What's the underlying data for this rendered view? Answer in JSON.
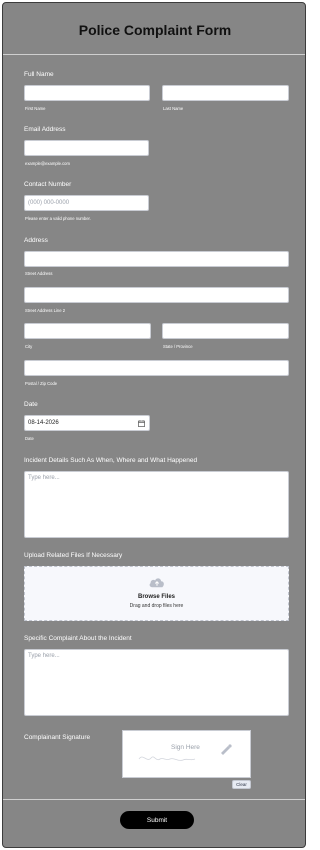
{
  "form": {
    "title": "Police Complaint Form",
    "submit_label": "Submit"
  },
  "full_name": {
    "label": "Full Name",
    "first_sub": "First Name",
    "last_sub": "Last Name",
    "first_value": "",
    "last_value": ""
  },
  "email": {
    "label": "Email Address",
    "sub": "example@example.com",
    "value": ""
  },
  "contact": {
    "label": "Contact Number",
    "placeholder": "(000) 000-0000",
    "sub": "Please enter a valid phone number."
  },
  "address": {
    "label": "Address",
    "street_sub": "Street Address",
    "street2_sub": "Street Address Line 2",
    "city_sub": "City",
    "state_sub": "State / Province",
    "postal_sub": "Postal / Zip Code"
  },
  "date": {
    "label": "Date",
    "value": "08-14-2026",
    "sub": "Date",
    "icon": "calendar-icon"
  },
  "incident": {
    "label": "Incident Details Such As When, Where and What Happened",
    "placeholder": "Type here..."
  },
  "upload": {
    "label": "Upload Related Files If Necessary",
    "browse": "Browse Files",
    "drag": "Drag and drop files here",
    "icon": "cloud-upload-icon"
  },
  "complaint": {
    "label": "Specific Complaint About the Incident",
    "placeholder": "Type here..."
  },
  "signature": {
    "label": "Complainant Signature",
    "placeholder": "Sign Here",
    "clear": "Clear",
    "icon": "pen-icon"
  },
  "colors": {
    "background": "#868686",
    "submit": "#000000",
    "input_border": "#c9ccd3"
  }
}
